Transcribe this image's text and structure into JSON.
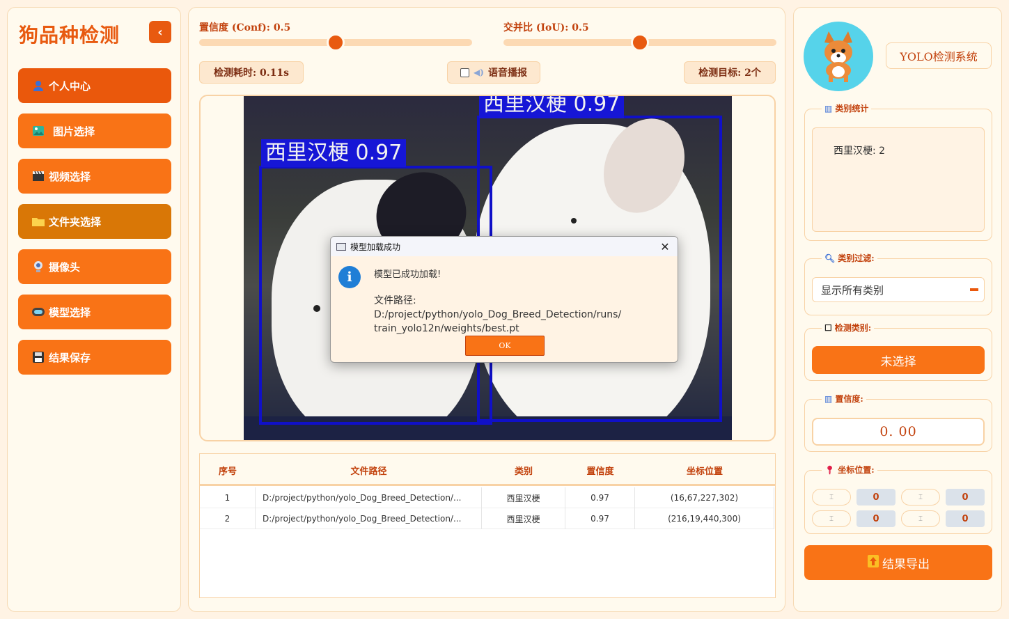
{
  "sidebar": {
    "title": "狗品种检测",
    "collapse_icon": "chevron-left-icon",
    "items": [
      {
        "label": "个人中心",
        "icon": "user-icon"
      },
      {
        "label": "图片选择",
        "icon": "image-icon"
      },
      {
        "label": "视频选择",
        "icon": "clapperboard-icon"
      },
      {
        "label": "文件夹选择",
        "icon": "folder-icon"
      },
      {
        "label": "摄像头",
        "icon": "webcam-icon"
      },
      {
        "label": "模型选择",
        "icon": "model-icon"
      },
      {
        "label": "结果保存",
        "icon": "floppy-icon"
      }
    ]
  },
  "controls": {
    "conf_label": "置信度 (Conf): 0.5",
    "conf_value": 0.5,
    "iou_label": "交并比 (IoU): 0.5",
    "iou_value": 0.5,
    "time_label": "检测耗时: 0.11s",
    "voice_label": "语音播报",
    "voice_checked": false,
    "target_label": "检测目标: 2个"
  },
  "detections_image": {
    "labels": [
      "西里汉梗 0.97",
      "西里汉梗 0.97"
    ]
  },
  "table": {
    "headers": [
      "序号",
      "文件路径",
      "类别",
      "置信度",
      "坐标位置"
    ],
    "rows": [
      [
        "1",
        "D:/project/python/yolo_Dog_Breed_Detection/...",
        "西里汉梗",
        "0.97",
        "(16,67,227,302)"
      ],
      [
        "2",
        "D:/project/python/yolo_Dog_Breed_Detection/...",
        "西里汉梗",
        "0.97",
        "(216,19,440,300)"
      ]
    ]
  },
  "right": {
    "system_name": "YOLO检测系统",
    "stats_title": "类别统计",
    "stats_text": "西里汉梗: 2",
    "filter_title": "类别过滤:",
    "filter_value": "显示所有类别",
    "detect_title": "检测类别:",
    "detect_button": "未选择",
    "conf_title": "置信度:",
    "conf_value": "0. 00",
    "coord_title": "坐标位置:",
    "coords": [
      "0",
      "0",
      "0",
      "0"
    ],
    "export_button": "结果导出"
  },
  "dialog": {
    "title": "模型加载成功",
    "message": "模型已成功加载!",
    "path_line1": "文件路径: D:/project/python/yolo_Dog_Breed_Detection/runs/",
    "path_line2": "train_yolo12n/weights/best.pt",
    "ok_label": "OK",
    "close_icon": "close-icon",
    "info_icon": "info-icon"
  },
  "colors": {
    "accent": "#f97316",
    "accent_dark": "#ea580c",
    "panel_bg": "#fffaee",
    "page_bg": "#fff3e4",
    "box_blue": "#1010c8"
  }
}
